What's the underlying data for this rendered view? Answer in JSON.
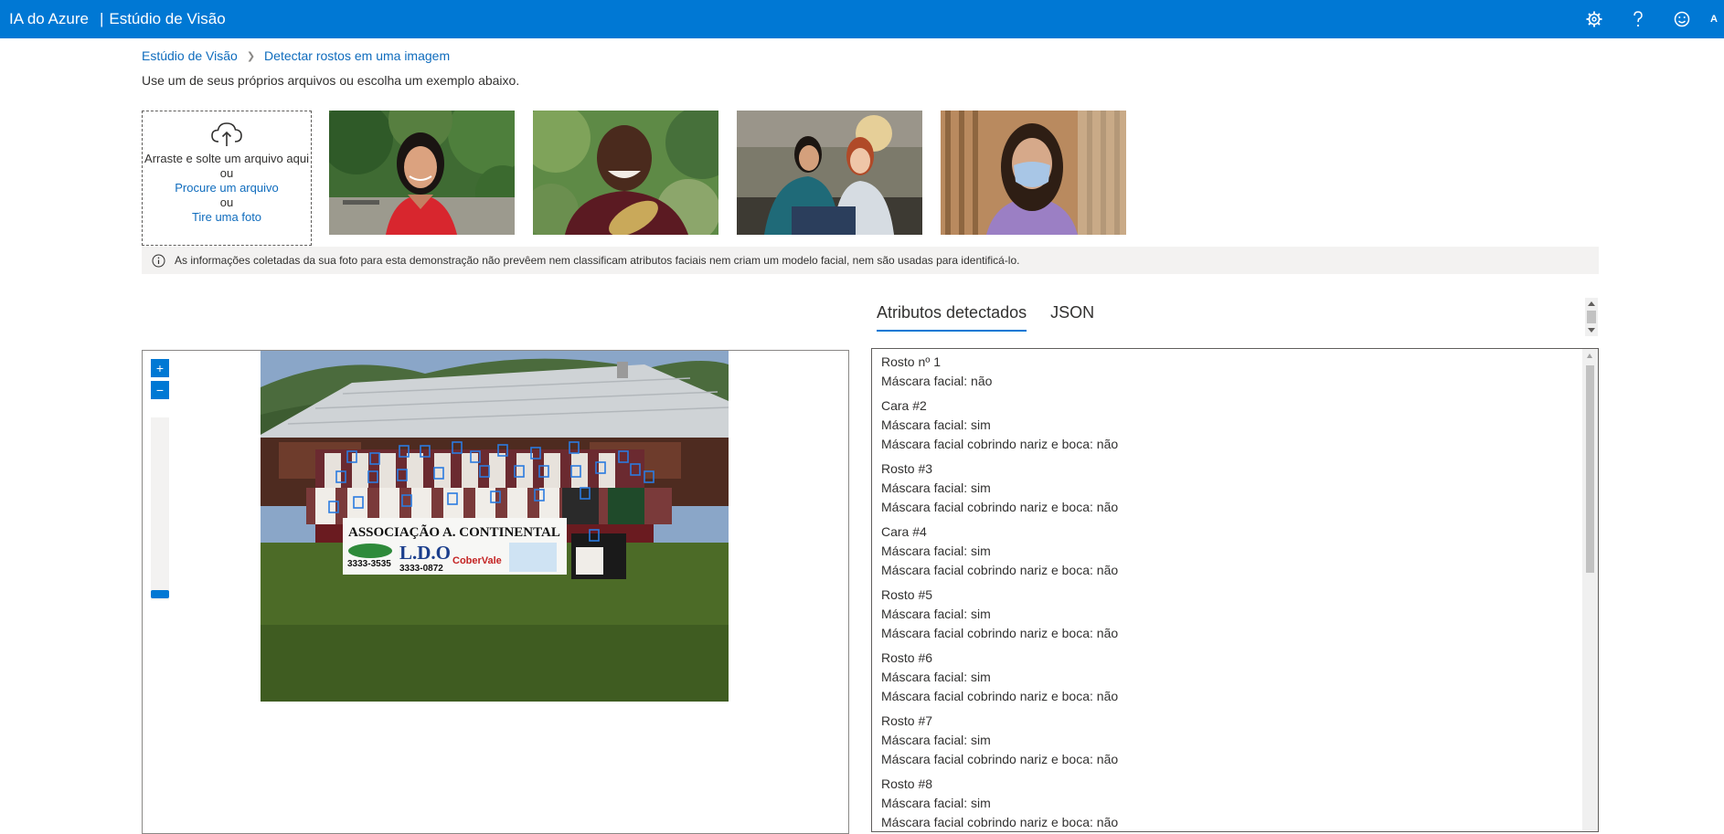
{
  "topbar": {
    "brand": "IA do Azure",
    "separator": "|",
    "product": "Estúdio de Visão",
    "icons": [
      "gear-icon",
      "help-icon",
      "feedback-smiley-icon"
    ],
    "avatar_initial": "A",
    "color": "#0078d4"
  },
  "breadcrumb": {
    "root": "Estúdio de Visão",
    "current": "Detectar rostos em uma imagem"
  },
  "instructions": "Use um de seus próprios arquivos ou escolha um exemplo abaixo.",
  "upload": {
    "drag_text": "Arraste e solte um arquivo aqui",
    "or1": "ou",
    "browse_link": "Procure um arquivo",
    "or2": "ou",
    "photo_link": "Tire uma foto"
  },
  "samples": [
    "sample-woman-red-top",
    "sample-man-smiling",
    "sample-two-women",
    "sample-woman-mask"
  ],
  "info_text": "As informações coletadas da sua foto para esta demonstração não prevêem nem classificam atributos faciais nem criam um modelo facial, nem são usadas para identificá-lo.",
  "tabs": [
    {
      "label": "Atributos detectados",
      "active": true
    },
    {
      "label": "JSON",
      "active": false
    }
  ],
  "viewer": {
    "zoom_in": "+",
    "zoom_out": "−",
    "banner_text": "ASSOCIAÇÃO A. CONTINENTAL",
    "banner_phone1": "3333-3535",
    "banner_brand1": "L.D.O",
    "banner_phone2": "3333-0872",
    "banner_brand2": "CoberVale"
  },
  "results": [
    {
      "title": "Rosto nº 1",
      "lines": [
        "Máscara facial: não"
      ]
    },
    {
      "title": "Cara #2",
      "lines": [
        "Máscara facial: sim",
        "Máscara facial cobrindo nariz e boca: não"
      ]
    },
    {
      "title": "Rosto #3",
      "lines": [
        "Máscara facial: sim",
        "Máscara facial cobrindo nariz e boca: não"
      ]
    },
    {
      "title": "Cara #4",
      "lines": [
        "Máscara facial: sim",
        "Máscara facial cobrindo nariz e boca: não"
      ]
    },
    {
      "title": "Rosto #5",
      "lines": [
        "Máscara facial: sim",
        "Máscara facial cobrindo nariz e boca: não"
      ]
    },
    {
      "title": "Rosto #6",
      "lines": [
        "Máscara facial: sim",
        "Máscara facial cobrindo nariz e boca: não"
      ]
    },
    {
      "title": "Rosto #7",
      "lines": [
        "Máscara facial: sim",
        "Máscara facial cobrindo nariz e boca: não"
      ]
    },
    {
      "title": "Rosto #8",
      "lines": [
        "Máscara facial: sim",
        "Máscara facial cobrindo nariz e boca: não"
      ]
    }
  ]
}
